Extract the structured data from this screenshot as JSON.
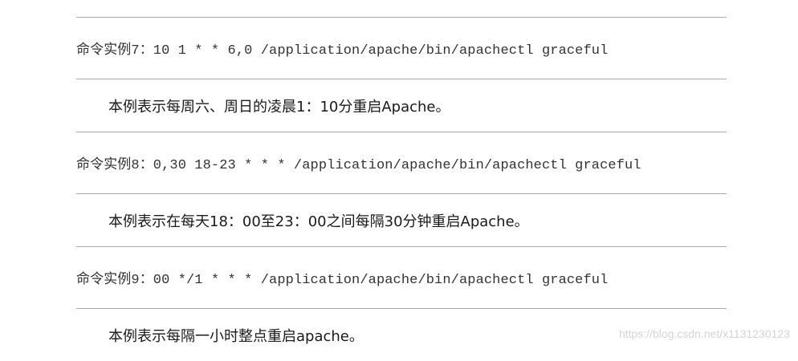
{
  "examples": [
    {
      "command": "命令实例7：10 1 * * 6,0 /application/apache/bin/apachectl graceful",
      "description": "本例表示每周六、周日的凌晨1：10分重启Apache。"
    },
    {
      "command": "命令实例8：0,30 18-23 * * * /application/apache/bin/apachectl graceful",
      "description": "本例表示在每天18：00至23：00之间每隔30分钟重启Apache。"
    },
    {
      "command": "命令实例9：00 */1 * * * /application/apache/bin/apachectl graceful",
      "description": "本例表示每隔一小时整点重启apache。"
    }
  ],
  "watermark": "https://blog.csdn.net/x1131230123"
}
